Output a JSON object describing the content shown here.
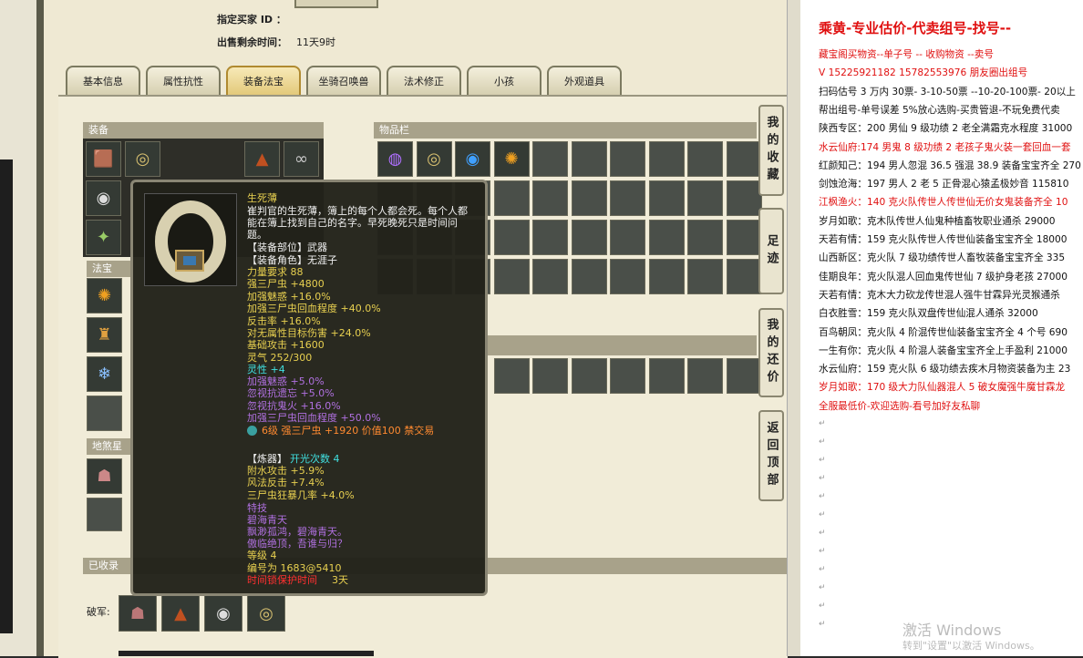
{
  "seller": {
    "label": "指定买家 ID ：",
    "time_label": "出售剩余时间：",
    "time_value": "11天9时"
  },
  "tabs": [
    "基本信息",
    "属性抗性",
    "装备法宝",
    "坐骑召唤兽",
    "法术修正",
    "小孩",
    "外观道具"
  ],
  "active_tab": "装备法宝",
  "sections": {
    "equipment": "装备",
    "inventory": "物品栏",
    "magic": "法宝",
    "title_fx": "地煞星",
    "collected": "已收录",
    "po_jun": "破军:"
  },
  "side_buttons": [
    "我的收藏",
    "足迹",
    "我的还价",
    "返回顶部"
  ],
  "tooltip": {
    "name": "生死薄",
    "desc1": "崔判官的生死薄，簿上的每个人都会死。每个人都",
    "desc2": "能在簿上找到自己的名字。早死晚死只是时间问",
    "desc3": "题。",
    "slot": "【装备部位】武器",
    "role": "【装备角色】无涯子",
    "lines_yellow": [
      "力量要求 88",
      "强三尸虫 +4800",
      "加强魅惑 +16.0%",
      "加强三尸虫回血程度 +40.0%",
      "反击率 +16.0%",
      "对无属性目标伤害 +24.0%",
      "基础攻击 +1600",
      "灵气 252/300"
    ],
    "spirit": "灵性 +4",
    "lines_purple": [
      "加强魅惑 +5.0%",
      "忽视抗遗忘 +5.0%",
      "忽视抗鬼火 +16.0%",
      "加强三尸虫回血程度 +50.0%"
    ],
    "gem": "6级 强三尸虫 +1920 价值100 禁交易",
    "refine_head": "【炼器】",
    "refine_count": "开光次数 4",
    "refine_lines": [
      "附水攻击 +5.9%",
      "风法反击 +7.4%",
      "三尸虫狂暴几率 +4.0%"
    ],
    "skill_head": "特技",
    "skill_lines": [
      "碧海青天",
      "飘渺孤鸿，碧海青天。",
      "傲临绝顶，吾谁与归？"
    ],
    "level": "等级 4",
    "serial": "编号为 1683@5410",
    "timelimit_label": "时间锁保护时间",
    "timelimit_value": "3天"
  },
  "doc": {
    "title": "乘黄-专业估价-代卖组号-找号--",
    "lines": [
      {
        "text": "藏宝阁买物资--单子号 -- 收购物资 --卖号",
        "red": true
      },
      {
        "text": "V 15225921182 15782553976 朋友圈出组号",
        "red": true
      },
      {
        "text": "扫码估号 3 万内 30票- 3-10-50票 --10-20-100票- 20以上",
        "red": false
      },
      {
        "text": "帮出组号-单号误差 5%放心选购-买贵管退-不玩免费代卖",
        "red": false
      },
      {
        "text": "陕西专区：200 男仙 9 级功绩 2 老全满霜克水程度 31000",
        "red": false
      },
      {
        "text": "水云仙府:174 男鬼 8 级功绩 2 老孩子鬼火装一套回血一套",
        "red": true
      },
      {
        "text": "红颜知己：194 男人忽混 36.5 强混 38.9 装备宝宝齐全 270",
        "red": false
      },
      {
        "text": "剑蚀沧海：197 男人 2 老 5 正骨混心猿孟极妙音 115810",
        "red": false
      },
      {
        "text": "江枫渔火：140 克火队传世人传世仙无价女鬼装备齐全 10",
        "red": true
      },
      {
        "text": "岁月如歌：克木队传世人仙鬼种植畜牧职业通杀 29000",
        "red": false
      },
      {
        "text": "天若有情：159 克火队传世人传世仙装备宝宝齐全 18000",
        "red": false
      },
      {
        "text": "山西新区：克火队 7 级功绩传世人畜牧装备宝宝齐全 335",
        "red": false
      },
      {
        "text": "佳期良年：克火队混人回血鬼传世仙 7 级护身老孩 27000",
        "red": false
      },
      {
        "text": "天若有情：克木大力砍龙传世混人强牛甘霖异光灵猴通杀",
        "red": false
      },
      {
        "text": "白衣胜雪：159 克火队双盘传世仙混人通杀 32000",
        "red": false
      },
      {
        "text": "百鸟朝凤：克火队 4 阶混传世仙装备宝宝齐全 4 个号 690",
        "red": false
      },
      {
        "text": "一生有你：克火队 4 阶混人装备宝宝齐全上手盈利 21000",
        "red": false
      },
      {
        "text": "水云仙府：159 克火队 6 级功绩去疾木月物资装备为主 23",
        "red": false
      },
      {
        "text": "岁月如歌：170 级大力队仙器混人 5 破女魔强牛魔甘霖龙",
        "red": true
      },
      {
        "text": "全服最低价-欢迎选购-看号加好友私聊",
        "red": true
      }
    ]
  },
  "watermark": {
    "line1": "激活 Windows",
    "line2": "转到\"设置\"以激活 Windows。"
  },
  "colors": {
    "tooltip_bg": "#22221a",
    "tooltip_yellow": "#e8d050",
    "tooltip_purple": "#b070e0",
    "tooltip_cyan": "#40e0e0",
    "tooltip_orange": "#ff8a30",
    "tooltip_red": "#ff3030",
    "doc_red": "#e01010"
  }
}
